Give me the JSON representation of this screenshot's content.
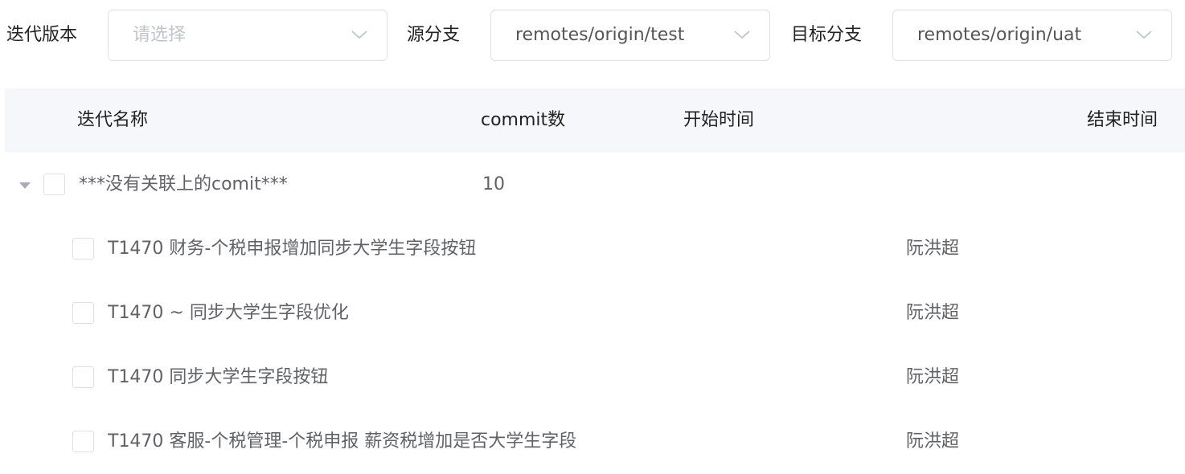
{
  "filters": {
    "version": {
      "label": "迭代版本",
      "placeholder": "请选择",
      "value": ""
    },
    "source_branch": {
      "label": "源分支",
      "value": "remotes/origin/test"
    },
    "target_branch": {
      "label": "目标分支",
      "value": "remotes/origin/uat"
    }
  },
  "table": {
    "columns": {
      "name": "迭代名称",
      "commits": "commit数",
      "start": "开始时间",
      "end": "结束时间"
    },
    "group": {
      "name": "***没有关联上的comit***",
      "commits": "10",
      "expanded": true
    },
    "rows": [
      {
        "title": "T1470 财务-个税申报增加同步大学生字段按钮",
        "author": "阮洪超"
      },
      {
        "title": "T1470 ~ 同步大学生字段优化",
        "author": "阮洪超"
      },
      {
        "title": "T1470 同步大学生字段按钮",
        "author": "阮洪超"
      },
      {
        "title": "T1470 客服-个税管理-个税申报 薪资税增加是否大学生字段",
        "author": "阮洪超"
      }
    ]
  },
  "icons": {
    "select_arrow": "chevron-down-icon",
    "tree_toggle": "caret-down-icon"
  }
}
